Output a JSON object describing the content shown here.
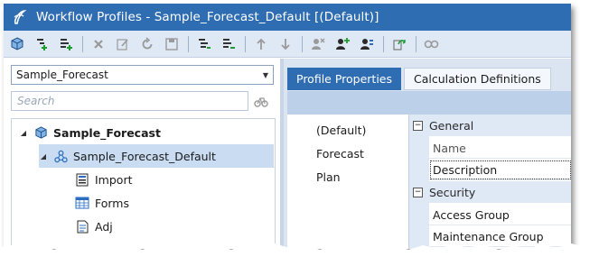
{
  "window": {
    "title": "Workflow Profiles - Sample_Forecast_Default [(Default)]",
    "accent_color": "#2f6db3"
  },
  "toolbar": {
    "buttons": [
      {
        "name": "cube-icon"
      },
      {
        "name": "add-profile-icon"
      },
      {
        "name": "add-child-icon"
      },
      {
        "name": "delete-icon"
      },
      {
        "name": "rename-icon"
      },
      {
        "name": "refresh-icon"
      },
      {
        "name": "save-icon"
      },
      {
        "name": "indent-icon"
      },
      {
        "name": "outdent-icon"
      },
      {
        "name": "move-up-icon"
      },
      {
        "name": "move-down-icon"
      },
      {
        "name": "remove-user-icon"
      },
      {
        "name": "add-user-icon"
      },
      {
        "name": "user-settings-icon"
      },
      {
        "name": "copy-icon"
      },
      {
        "name": "permissions-icon"
      }
    ]
  },
  "left": {
    "cube_select": "Sample_Forecast",
    "search_placeholder": "Search",
    "tree": [
      {
        "label": "Sample_Forecast",
        "icon": "cube-icon",
        "bold": true
      },
      {
        "label": "Sample_Forecast_Default",
        "icon": "workflow-icon",
        "bold": false
      },
      {
        "label": "Import",
        "icon": "import-icon",
        "bold": false
      },
      {
        "label": "Forms",
        "icon": "forms-icon",
        "bold": false
      },
      {
        "label": "Adj",
        "icon": "adjustment-icon",
        "bold": false
      }
    ]
  },
  "right": {
    "tabs": [
      {
        "label": "Profile Properties",
        "active": true
      },
      {
        "label": "Calculation Definitions",
        "active": false
      }
    ],
    "profiles": [
      "(Default)",
      "Forecast",
      "Plan"
    ],
    "categories": [
      {
        "label": "General",
        "properties": [
          "Name",
          "Description"
        ]
      },
      {
        "label": "Security",
        "properties": [
          "Access Group",
          "Maintenance Group"
        ]
      }
    ]
  }
}
